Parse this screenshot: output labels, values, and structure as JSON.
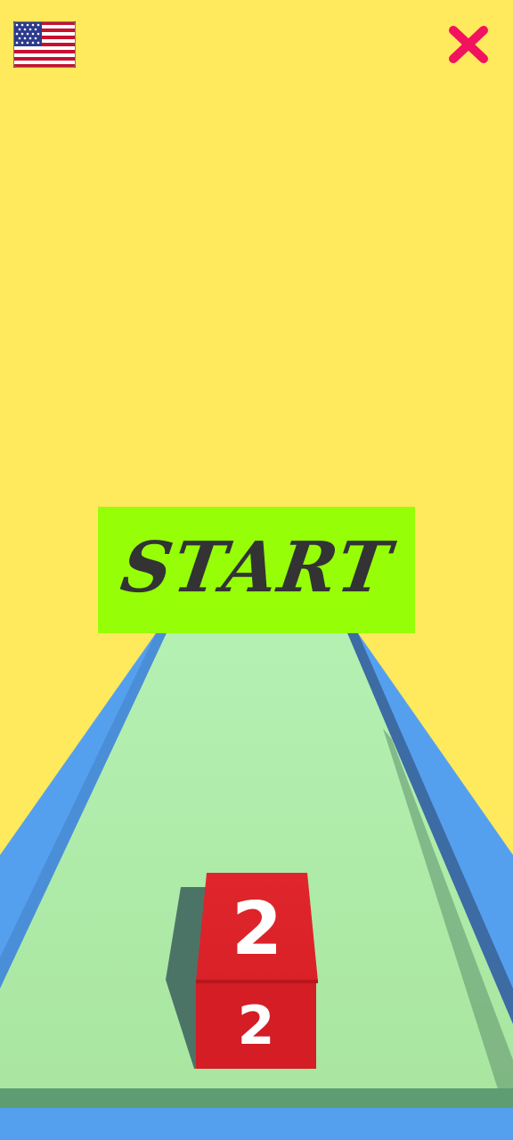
{
  "colors": {
    "background": "#FFE95C",
    "track_surface": "#ADE9A5",
    "track_wall": "#55A0EE",
    "track_wall_dark": "#3D6BA3",
    "start_button": "#96FF08",
    "start_text": "#333333",
    "close_icon": "#F2125E",
    "cube": "#D92128"
  },
  "header": {
    "language_flag_icon": "us-flag-icon",
    "close_icon": "close-icon"
  },
  "start": {
    "label": "START"
  },
  "player_cube": {
    "top_value": "2",
    "front_value": "2"
  }
}
